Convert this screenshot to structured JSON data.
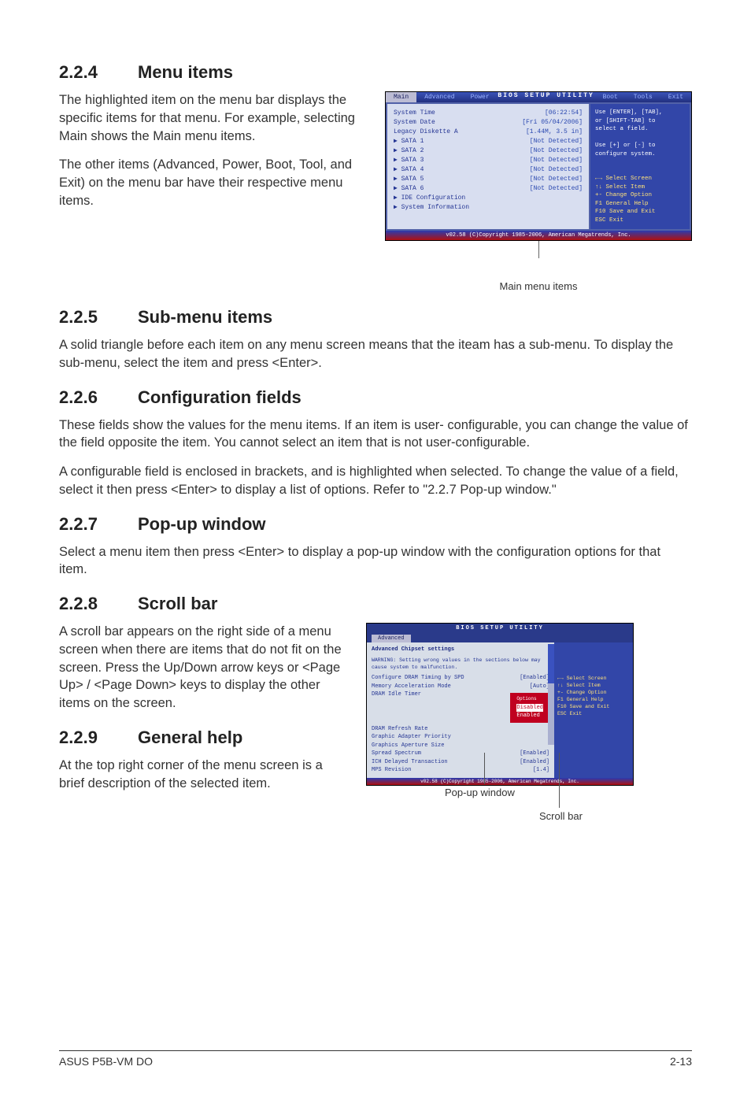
{
  "sec224": {
    "num": "2.2.4",
    "title": "Menu items",
    "p1": "The highlighted item on the menu bar  displays the specific items for that menu. For example, selecting Main shows the Main menu items.",
    "p2": "The other items (Advanced, Power, Boot, Tool, and Exit) on the menu bar have their respective menu items."
  },
  "bios1": {
    "title": "BIOS SETUP UTILITY",
    "tabs": [
      "Main",
      "Advanced",
      "Power",
      "Boot",
      "Tools",
      "Exit"
    ],
    "rows": [
      [
        "System Time",
        "[06:22:54]"
      ],
      [
        "System Date",
        "[Fri 05/04/2006]"
      ],
      [
        "Legacy Diskette A",
        "[1.44M, 3.5 in]"
      ],
      [
        "",
        ""
      ],
      [
        "▶ SATA 1",
        "[Not Detected]"
      ],
      [
        "▶ SATA 2",
        "[Not Detected]"
      ],
      [
        "▶ SATA 3",
        "[Not Detected]"
      ],
      [
        "▶ SATA 4",
        "[Not Detected]"
      ],
      [
        "▶ SATA 5",
        "[Not Detected]"
      ],
      [
        "▶ SATA 6",
        "[Not Detected]"
      ],
      [
        "",
        ""
      ],
      [
        "▶ IDE Configuration",
        ""
      ],
      [
        "▶ System Information",
        ""
      ]
    ],
    "help1": "Use [ENTER], [TAB],",
    "help2": "or [SHIFT-TAB] to",
    "help3": "select a field.",
    "help4": "Use [+] or [-] to",
    "help5": "configure system.",
    "nav": [
      [
        "←→",
        "Select Screen"
      ],
      [
        "↑↓",
        "Select Item"
      ],
      [
        "+-",
        "Change Option"
      ],
      [
        "F1",
        "General Help"
      ],
      [
        "F10",
        "Save and Exit"
      ],
      [
        "ESC",
        "Exit"
      ]
    ],
    "foot": "v02.58 (C)Copyright 1985-2006, American Megatrends, Inc."
  },
  "cap1": "Main menu items",
  "sec225": {
    "num": "2.2.5",
    "title": "Sub-menu items",
    "p1": "A solid triangle before each item on any menu screen means that the iteam has a sub-menu. To display the sub-menu, select the item and press <Enter>."
  },
  "sec226": {
    "num": "2.2.6",
    "title": "Configuration fields",
    "p1": "These fields show the values for the menu items. If an item is user- configurable, you can change the value of the field opposite the item. You cannot select an item that is not user-configurable.",
    "p2": "A configurable field is enclosed in brackets, and is highlighted when selected. To change the value of a field, select it then press <Enter> to display a list of options. Refer to \"2.2.7 Pop-up window.\""
  },
  "sec227": {
    "num": "2.2.7",
    "title": "Pop-up window",
    "p1": "Select a menu item then press <Enter> to display a pop-up window with the configuration options for that item."
  },
  "sec228": {
    "num": "2.2.8",
    "title": "Scroll bar",
    "p1": "A scroll bar appears on the right side of a menu screen when there are items that do not fit on the screen. Press the Up/Down arrow keys or <Page Up> / <Page Down> keys to display the other items on the screen."
  },
  "sec229": {
    "num": "2.2.9",
    "title": "General help",
    "p1": "At the top right corner of the menu screen is a brief description of the selected item."
  },
  "bios2": {
    "title": "BIOS SETUP UTILITY",
    "tab": "Advanced",
    "heading": "Advanced Chipset settings",
    "warn": "WARNING: Setting wrong values in the sections below may cause system to malfunction.",
    "rows": [
      [
        "Configure DRAM Timing by SPD",
        "[Enabled]"
      ],
      [
        "Memory Acceleration Mode",
        "[Auto]"
      ],
      [
        "DRAM Idle Timer",
        ""
      ],
      [
        "DRAM Refresh Rate",
        ""
      ]
    ],
    "popup_title": "Options",
    "popup": [
      "Disabled",
      "Enabled"
    ],
    "rows2": [
      [
        "Graphic Adapter Priority",
        ""
      ],
      [
        "Graphics Aperture Size",
        ""
      ],
      [
        "Spread Spectrum",
        "[Enabled]"
      ],
      [
        "",
        ""
      ],
      [
        "ICH Delayed Transaction",
        "[Enabled]"
      ],
      [
        "",
        ""
      ],
      [
        "MPS Revision",
        "[1.4]"
      ]
    ],
    "nav": [
      [
        "←→",
        "Select Screen"
      ],
      [
        "↑↓",
        "Select Item"
      ],
      [
        "+-",
        "Change Option"
      ],
      [
        "F1",
        "General Help"
      ],
      [
        "F10",
        "Save and Exit"
      ],
      [
        "ESC",
        "Exit"
      ]
    ],
    "foot": "v02.58 (C)Copyright 1985-2006, American Megatrends, Inc."
  },
  "cap2": "Pop-up window",
  "cap3": "Scroll bar",
  "footer": {
    "left": "ASUS P5B-VM DO",
    "right": "2-13"
  }
}
